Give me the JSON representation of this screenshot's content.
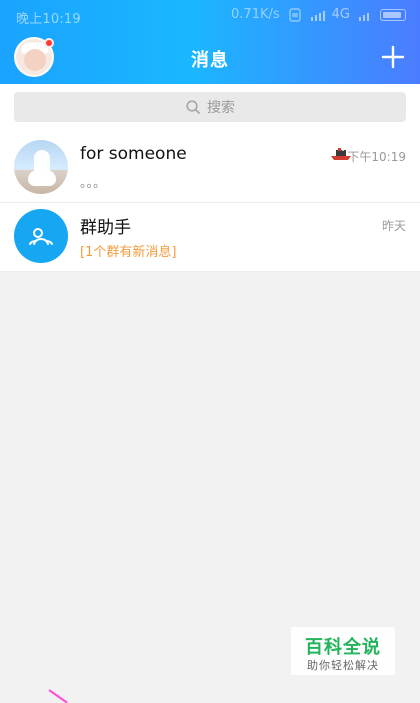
{
  "status_bar": {
    "time": "晚上10:19",
    "speed": "0.71K/s",
    "network": "4G"
  },
  "header": {
    "title": "消息",
    "plus_icon": "plus-icon"
  },
  "search": {
    "placeholder": "搜索",
    "icon": "search-icon"
  },
  "conversations": [
    {
      "name": "for  someone",
      "preview": "。。。",
      "time": "下午10:19",
      "badge_icon": "ship-icon"
    },
    {
      "name": "群助手",
      "preview": "[1个群有新消息]",
      "time": "昨天"
    }
  ],
  "watermark": {
    "main": "百科全说",
    "sub": "助你轻松解决"
  },
  "colors": {
    "header_blue": "#1aa3ff",
    "accent_orange": "#f59a3c",
    "group_blue": "#16a6f2",
    "watermark_green": "#22b45a"
  }
}
